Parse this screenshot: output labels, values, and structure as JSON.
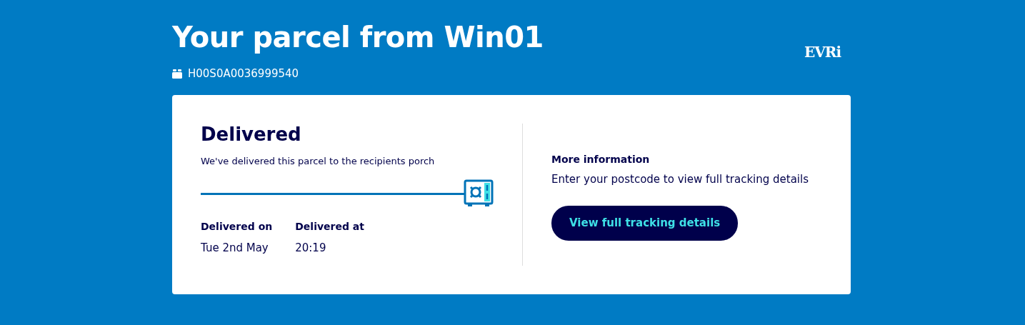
{
  "header": {
    "title": "Your parcel from Win01",
    "tracking_number": "H00S0A0036999540",
    "logo": "EVRi"
  },
  "status": {
    "title": "Delivered",
    "message": "We've delivered this parcel to the recipients porch",
    "level": 1
  },
  "details": [
    {
      "label": "Delivered on",
      "value": "Tue 2nd May"
    },
    {
      "label": "Delivered at",
      "value": "20:19"
    }
  ],
  "more_info": {
    "title": "More information",
    "text": "Enter your postcode to view full tracking details",
    "button": "View full tracking details"
  }
}
